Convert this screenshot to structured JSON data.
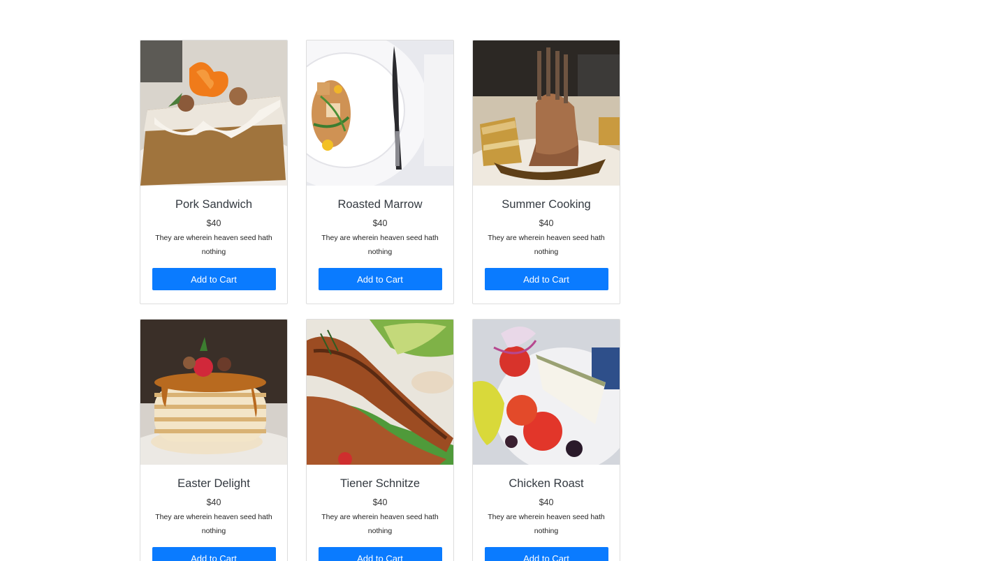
{
  "products": [
    {
      "title": "Pork Sandwich",
      "price": "$40",
      "description": "They are wherein heaven seed hath nothing",
      "button": "Add to Cart",
      "image_icon": "carrot-cake-photo"
    },
    {
      "title": "Roasted Marrow",
      "price": "$40",
      "description": "They are wherein heaven seed hath nothing",
      "button": "Add to Cart",
      "image_icon": "plated-salad-photo"
    },
    {
      "title": "Summer Cooking",
      "price": "$40",
      "description": "They are wherein heaven seed hath nothing",
      "button": "Add to Cart",
      "image_icon": "rack-of-lamb-photo"
    },
    {
      "title": "Easter Delight",
      "price": "$40",
      "description": "They are wherein heaven seed hath nothing",
      "button": "Add to Cart",
      "image_icon": "pancake-stack-photo"
    },
    {
      "title": "Tiener Schnitze",
      "price": "$40",
      "description": "They are wherein heaven seed hath nothing",
      "button": "Add to Cart",
      "image_icon": "grilled-salmon-photo"
    },
    {
      "title": "Chicken Roast",
      "price": "$40",
      "description": "They are wherein heaven seed hath nothing",
      "button": "Add to Cart",
      "image_icon": "greek-salad-photo"
    }
  ],
  "colors": {
    "button": "#0a7bff",
    "button_text": "#ffffff",
    "card_border": "#dddddd",
    "title_text": "#333940"
  }
}
